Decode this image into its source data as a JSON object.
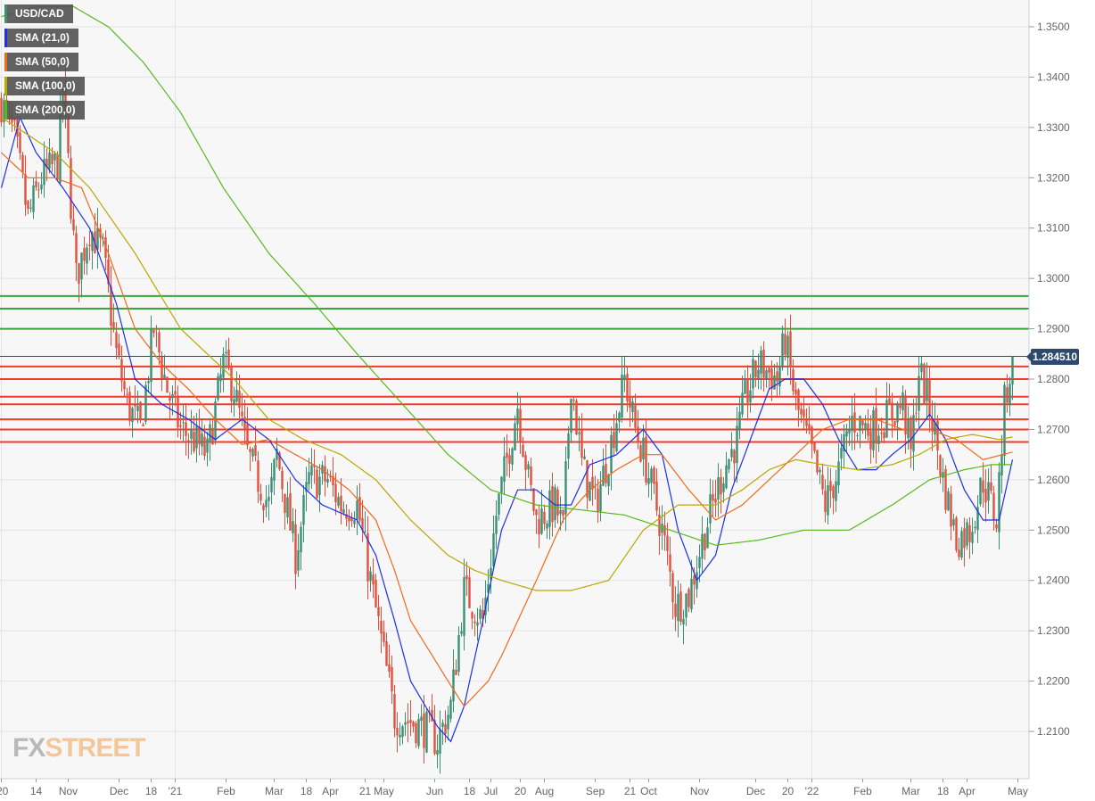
{
  "chart_data": {
    "type": "candlestick",
    "symbol": "USD/CAD",
    "last_price": "1.284510",
    "legend": [
      {
        "label": "USD/CAD",
        "color": "#3a8f75"
      },
      {
        "label": "SMA (21,0)",
        "color": "#1a2ff0"
      },
      {
        "label": "SMA (50,0)",
        "color": "#f06a1a"
      },
      {
        "label": "SMA (100,0)",
        "color": "#b8a800"
      },
      {
        "label": "SMA (200,0)",
        "color": "#5ab81a"
      }
    ],
    "ylim": [
      1.2025,
      1.3555
    ],
    "y_ticks": [
      "1.2100",
      "1.2200",
      "1.2300",
      "1.2400",
      "1.2500",
      "1.2600",
      "1.2700",
      "1.2800",
      "1.2900",
      "1.3000",
      "1.3100",
      "1.3200",
      "1.3300",
      "1.3400",
      "1.3500"
    ],
    "x_ticks": [
      [
        0,
        "'20"
      ],
      [
        13,
        "14"
      ],
      [
        25,
        "Nov"
      ],
      [
        44,
        "Dec"
      ],
      [
        56,
        "18"
      ],
      [
        65,
        "'21"
      ],
      [
        84,
        "Feb"
      ],
      [
        102,
        "Mar"
      ],
      [
        114,
        "18"
      ],
      [
        123,
        "Apr"
      ],
      [
        136,
        "21"
      ],
      [
        143,
        "May"
      ],
      [
        162,
        "Jun"
      ],
      [
        175,
        "18"
      ],
      [
        183,
        "Jul"
      ],
      [
        194,
        "20"
      ],
      [
        203,
        "Aug"
      ],
      [
        222,
        "Sep"
      ],
      [
        235,
        "21"
      ],
      [
        242,
        "Oct"
      ],
      [
        261,
        "Nov"
      ],
      [
        282,
        "Dec"
      ],
      [
        294,
        "20"
      ],
      [
        303,
        "'22"
      ],
      [
        322,
        "Feb"
      ],
      [
        340,
        "Mar"
      ],
      [
        352,
        "18"
      ],
      [
        361,
        "Apr"
      ],
      [
        380,
        "May"
      ]
    ],
    "x_unit": "trading day index",
    "bull_color": "#3a8f75",
    "bear_color": "#e0503c",
    "price_path": [
      [
        0,
        1.335
      ],
      [
        5,
        1.328
      ],
      [
        10,
        1.312
      ],
      [
        15,
        1.32
      ],
      [
        21,
        1.323
      ],
      [
        23,
        1.338
      ],
      [
        28,
        1.3
      ],
      [
        33,
        1.31
      ],
      [
        38,
        1.305
      ],
      [
        43,
        1.285
      ],
      [
        47,
        1.275
      ],
      [
        52,
        1.27
      ],
      [
        57,
        1.29
      ],
      [
        62,
        1.278
      ],
      [
        67,
        1.27
      ],
      [
        72,
        1.268
      ],
      [
        77,
        1.265
      ],
      [
        83,
        1.283
      ],
      [
        87,
        1.278
      ],
      [
        92,
        1.265
      ],
      [
        100,
        1.255
      ],
      [
        103,
        1.265
      ],
      [
        110,
        1.245
      ],
      [
        115,
        1.26
      ],
      [
        122,
        1.26
      ],
      [
        127,
        1.255
      ],
      [
        133,
        1.255
      ],
      [
        138,
        1.24
      ],
      [
        143,
        1.225
      ],
      [
        147,
        1.213
      ],
      [
        153,
        1.212
      ],
      [
        160,
        1.21
      ],
      [
        163,
        1.208
      ],
      [
        168,
        1.215
      ],
      [
        173,
        1.238
      ],
      [
        180,
        1.232
      ],
      [
        185,
        1.253
      ],
      [
        193,
        1.275
      ],
      [
        197,
        1.26
      ],
      [
        200,
        1.252
      ],
      [
        207,
        1.255
      ],
      [
        210,
        1.25
      ],
      [
        213,
        1.28
      ],
      [
        217,
        1.263
      ],
      [
        222,
        1.255
      ],
      [
        227,
        1.265
      ],
      [
        233,
        1.28
      ],
      [
        237,
        1.27
      ],
      [
        240,
        1.265
      ],
      [
        247,
        1.25
      ],
      [
        252,
        1.235
      ],
      [
        257,
        1.237
      ],
      [
        263,
        1.25
      ],
      [
        270,
        1.262
      ],
      [
        275,
        1.268
      ],
      [
        278,
        1.276
      ],
      [
        283,
        1.283
      ],
      [
        290,
        1.28
      ],
      [
        293,
        1.288
      ],
      [
        297,
        1.275
      ],
      [
        303,
        1.265
      ],
      [
        308,
        1.255
      ],
      [
        313,
        1.262
      ],
      [
        318,
        1.272
      ],
      [
        325,
        1.27
      ],
      [
        330,
        1.272
      ],
      [
        337,
        1.275
      ],
      [
        340,
        1.265
      ],
      [
        343,
        1.282
      ],
      [
        348,
        1.272
      ],
      [
        352,
        1.26
      ],
      [
        357,
        1.248
      ],
      [
        362,
        1.25
      ],
      [
        367,
        1.26
      ],
      [
        372,
        1.252
      ],
      [
        375,
        1.275
      ],
      [
        378,
        1.2845
      ]
    ],
    "sma": [
      {
        "name": "SMA (21,0)",
        "color": "#1a2ff0",
        "points": [
          [
            0,
            1.318
          ],
          [
            7,
            1.332
          ],
          [
            13,
            1.325
          ],
          [
            23,
            1.318
          ],
          [
            33,
            1.31
          ],
          [
            43,
            1.295
          ],
          [
            50,
            1.28
          ],
          [
            60,
            1.275
          ],
          [
            70,
            1.272
          ],
          [
            80,
            1.268
          ],
          [
            90,
            1.272
          ],
          [
            100,
            1.268
          ],
          [
            110,
            1.26
          ],
          [
            120,
            1.255
          ],
          [
            133,
            1.252
          ],
          [
            140,
            1.245
          ],
          [
            147,
            1.232
          ],
          [
            153,
            1.22
          ],
          [
            163,
            1.211
          ],
          [
            168,
            1.208
          ],
          [
            173,
            1.215
          ],
          [
            180,
            1.232
          ],
          [
            187,
            1.25
          ],
          [
            193,
            1.258
          ],
          [
            200,
            1.258
          ],
          [
            207,
            1.255
          ],
          [
            213,
            1.255
          ],
          [
            220,
            1.263
          ],
          [
            230,
            1.265
          ],
          [
            240,
            1.27
          ],
          [
            247,
            1.265
          ],
          [
            253,
            1.25
          ],
          [
            260,
            1.24
          ],
          [
            267,
            1.245
          ],
          [
            273,
            1.258
          ],
          [
            280,
            1.268
          ],
          [
            287,
            1.278
          ],
          [
            293,
            1.28
          ],
          [
            300,
            1.28
          ],
          [
            307,
            1.275
          ],
          [
            313,
            1.268
          ],
          [
            320,
            1.262
          ],
          [
            327,
            1.262
          ],
          [
            333,
            1.265
          ],
          [
            340,
            1.268
          ],
          [
            347,
            1.273
          ],
          [
            353,
            1.268
          ],
          [
            360,
            1.258
          ],
          [
            367,
            1.252
          ],
          [
            373,
            1.252
          ],
          [
            378,
            1.264
          ]
        ]
      },
      {
        "name": "SMA (50,0)",
        "color": "#f06a1a",
        "points": [
          [
            0,
            1.325
          ],
          [
            10,
            1.32
          ],
          [
            20,
            1.32
          ],
          [
            30,
            1.318
          ],
          [
            40,
            1.305
          ],
          [
            50,
            1.29
          ],
          [
            60,
            1.283
          ],
          [
            70,
            1.278
          ],
          [
            80,
            1.272
          ],
          [
            90,
            1.267
          ],
          [
            100,
            1.268
          ],
          [
            110,
            1.265
          ],
          [
            120,
            1.262
          ],
          [
            130,
            1.258
          ],
          [
            140,
            1.252
          ],
          [
            147,
            1.242
          ],
          [
            153,
            1.232
          ],
          [
            167,
            1.22
          ],
          [
            173,
            1.215
          ],
          [
            182,
            1.22
          ],
          [
            187,
            1.225
          ],
          [
            200,
            1.24
          ],
          [
            210,
            1.252
          ],
          [
            220,
            1.258
          ],
          [
            230,
            1.262
          ],
          [
            240,
            1.265
          ],
          [
            247,
            1.265
          ],
          [
            257,
            1.258
          ],
          [
            267,
            1.252
          ],
          [
            277,
            1.255
          ],
          [
            287,
            1.26
          ],
          [
            297,
            1.265
          ],
          [
            307,
            1.27
          ],
          [
            317,
            1.272
          ],
          [
            327,
            1.272
          ],
          [
            337,
            1.27
          ],
          [
            347,
            1.27
          ],
          [
            357,
            1.268
          ],
          [
            367,
            1.264
          ],
          [
            378,
            1.2655
          ]
        ]
      },
      {
        "name": "SMA (100,0)",
        "color": "#b8a800",
        "points": [
          [
            0,
            1.332
          ],
          [
            20,
            1.325
          ],
          [
            33,
            1.318
          ],
          [
            50,
            1.305
          ],
          [
            67,
            1.29
          ],
          [
            87,
            1.28
          ],
          [
            100,
            1.272
          ],
          [
            113,
            1.268
          ],
          [
            127,
            1.265
          ],
          [
            140,
            1.26
          ],
          [
            153,
            1.252
          ],
          [
            167,
            1.245
          ],
          [
            177,
            1.242
          ],
          [
            187,
            1.24
          ],
          [
            200,
            1.238
          ],
          [
            213,
            1.238
          ],
          [
            227,
            1.24
          ],
          [
            240,
            1.25
          ],
          [
            253,
            1.255
          ],
          [
            267,
            1.255
          ],
          [
            277,
            1.258
          ],
          [
            287,
            1.262
          ],
          [
            297,
            1.264
          ],
          [
            307,
            1.263
          ],
          [
            320,
            1.262
          ],
          [
            333,
            1.263
          ],
          [
            343,
            1.265
          ],
          [
            353,
            1.268
          ],
          [
            363,
            1.269
          ],
          [
            373,
            1.268
          ],
          [
            378,
            1.2685
          ]
        ]
      },
      {
        "name": "SMA (200,0)",
        "color": "#5ab81a",
        "points": [
          [
            0,
            1.352
          ],
          [
            13,
            1.354
          ],
          [
            27,
            1.354
          ],
          [
            40,
            1.35
          ],
          [
            53,
            1.343
          ],
          [
            67,
            1.333
          ],
          [
            83,
            1.318
          ],
          [
            100,
            1.305
          ],
          [
            117,
            1.295
          ],
          [
            133,
            1.285
          ],
          [
            150,
            1.275
          ],
          [
            167,
            1.265
          ],
          [
            183,
            1.258
          ],
          [
            200,
            1.255
          ],
          [
            217,
            1.254
          ],
          [
            233,
            1.253
          ],
          [
            250,
            1.25
          ],
          [
            267,
            1.247
          ],
          [
            283,
            1.248
          ],
          [
            300,
            1.25
          ],
          [
            317,
            1.25
          ],
          [
            333,
            1.255
          ],
          [
            347,
            1.26
          ],
          [
            360,
            1.262
          ],
          [
            370,
            1.263
          ],
          [
            378,
            1.263
          ]
        ]
      }
    ],
    "horizontal_levels": {
      "green": [
        1.2965,
        1.294,
        1.29
      ],
      "red": [
        1.2825,
        1.28,
        1.2765,
        1.275,
        1.272,
        1.27,
        1.2675
      ],
      "current": 1.28451,
      "green_color": "#3aa63a",
      "red_color": "#f03a2a",
      "current_color": "#2d4a6e"
    }
  },
  "branding": {
    "logo_fx": "FX",
    "logo_street": "STREET"
  }
}
